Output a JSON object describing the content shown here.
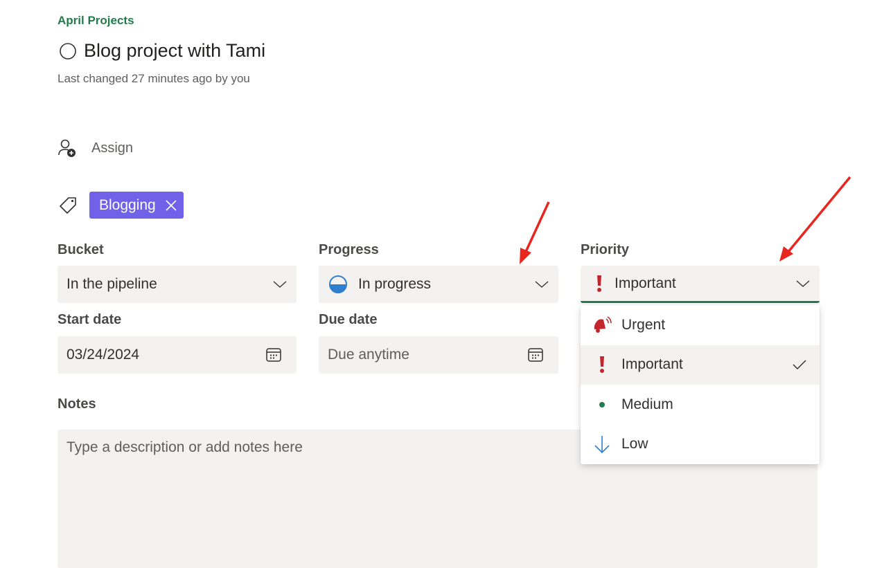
{
  "header": {
    "plan_name": "April Projects",
    "task_title": "Blog project with Tami",
    "last_changed": "Last changed 27 minutes ago by you"
  },
  "assign": {
    "label": "Assign"
  },
  "labels": [
    {
      "text": "Blogging",
      "color": "#7160e8"
    }
  ],
  "fields": {
    "bucket": {
      "label": "Bucket",
      "value": "In the pipeline"
    },
    "progress": {
      "label": "Progress",
      "value": "In progress"
    },
    "priority": {
      "label": "Priority",
      "value": "Important"
    },
    "start_date": {
      "label": "Start date",
      "value": "03/24/2024"
    },
    "due_date": {
      "label": "Due date",
      "placeholder": "Due anytime"
    }
  },
  "notes": {
    "label": "Notes",
    "placeholder": "Type a description or add notes here"
  },
  "priority_menu": {
    "items": [
      {
        "label": "Urgent",
        "icon": "urgent-bell-icon",
        "selected": false
      },
      {
        "label": "Important",
        "icon": "exclamation-icon",
        "selected": true
      },
      {
        "label": "Medium",
        "icon": "dot-icon",
        "selected": false
      },
      {
        "label": "Low",
        "icon": "down-arrow-icon",
        "selected": false
      }
    ]
  },
  "colors": {
    "accent_green": "#237b4b",
    "label_purple": "#7160e8",
    "priority_red": "#c4262e",
    "annotation_red": "#e8251f",
    "progress_blue": "#2f7fd0"
  }
}
